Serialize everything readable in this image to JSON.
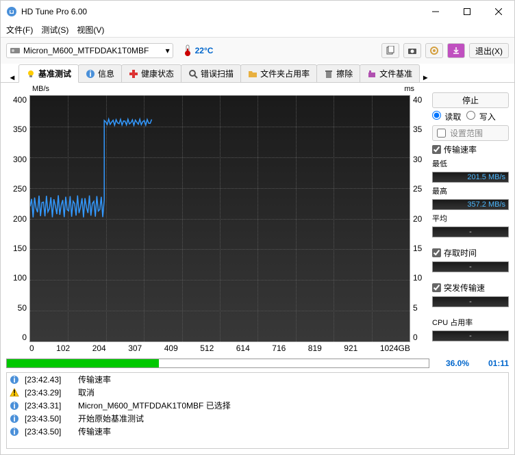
{
  "title": "HD Tune Pro 6.00",
  "menu": {
    "file": "文件(F)",
    "test": "测试(S)",
    "view": "视图(V)"
  },
  "drive": "Micron_M600_MTFDDAK1T0MBF",
  "temperature": "22°C",
  "exit_label": "退出(X)",
  "tabs": {
    "benchmark": "基准测试",
    "info": "信息",
    "health": "健康状态",
    "error": "错误扫描",
    "folder": "文件夹占用率",
    "erase": "擦除",
    "filebm": "文件基准"
  },
  "chart_data": {
    "type": "line",
    "xlabel_unit": "GB",
    "x_range": [
      0,
      1024
    ],
    "x_labels": [
      "0",
      "102",
      "204",
      "307",
      "409",
      "512",
      "614",
      "716",
      "819",
      "921",
      "1024GB"
    ],
    "left_axis": {
      "label": "MB/s",
      "min": 0,
      "max": 400,
      "ticks": [
        400,
        350,
        300,
        250,
        200,
        150,
        100,
        50,
        0
      ]
    },
    "right_axis": {
      "label": "ms",
      "min": 0,
      "max": 40,
      "ticks": [
        40,
        35,
        30,
        25,
        20,
        15,
        10,
        5,
        0
      ]
    },
    "series": [
      {
        "name": "传输速率",
        "color": "#3399ff",
        "approx_segments": [
          {
            "x0": 0,
            "x1": 200,
            "y_mean": 220,
            "y_amp": 18
          },
          {
            "x0": 200,
            "x1": 330,
            "y_mean": 357,
            "y_amp": 5
          }
        ]
      }
    ]
  },
  "controls": {
    "stop": "停止",
    "read": "读取",
    "write": "写入",
    "set_range": "设置范围",
    "transfer_rate": "传输速率",
    "min": "最低",
    "min_val": "201.5 MB/s",
    "max": "最高",
    "max_val": "357.2 MB/s",
    "avg": "平均",
    "avg_val": "-",
    "access": "存取时间",
    "access_val": "-",
    "burst": "突发传输速",
    "burst_val": "-",
    "cpu": "CPU 占用率",
    "cpu_val": "-"
  },
  "progress": {
    "pct": "36.0%",
    "time": "01:11",
    "fill": 36
  },
  "log": [
    {
      "icon": "info",
      "t": "[23:42.43]",
      "msg": "传输速率"
    },
    {
      "icon": "warn",
      "t": "[23:43.29]",
      "msg": "取消"
    },
    {
      "icon": "info",
      "t": "[23:43.31]",
      "msg": "Micron_M600_MTFDDAK1T0MBF 已选择"
    },
    {
      "icon": "info",
      "t": "[23:43.50]",
      "msg": "开始原始基准测试"
    },
    {
      "icon": "info",
      "t": "[23:43.50]",
      "msg": "传输速率"
    }
  ]
}
